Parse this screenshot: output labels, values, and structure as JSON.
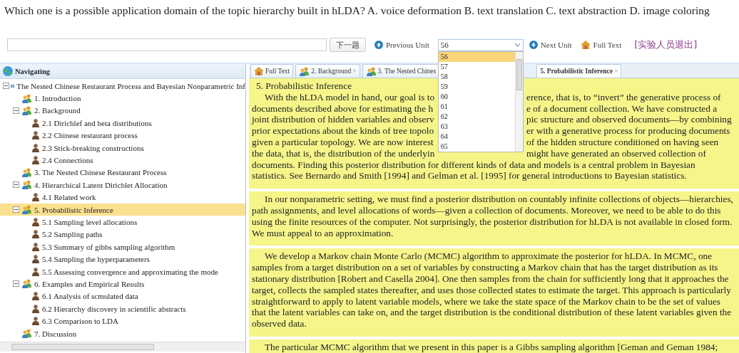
{
  "question": "Which one is a possible application domain of the topic hierarchy built in hLDA? A. voice deformation B. text translation C. text abstraction D. image coloring",
  "toolbar": {
    "next_question": "下一题",
    "previous_unit": "Previous Unit",
    "unit_select": {
      "value": "56",
      "options": [
        {
          "label": "56",
          "selected": true
        },
        {
          "label": "57",
          "selected": false
        },
        {
          "label": "58",
          "selected": false
        },
        {
          "label": "59",
          "selected": false
        },
        {
          "label": "60",
          "selected": false
        },
        {
          "label": "61",
          "selected": false
        },
        {
          "label": "62",
          "selected": false
        },
        {
          "label": "63",
          "selected": false
        },
        {
          "label": "64",
          "selected": false
        },
        {
          "label": "65",
          "selected": false
        }
      ]
    },
    "next_unit": "Next Unit",
    "full_text": "Full Text",
    "exit": "[实验人员退出]"
  },
  "sidebar": {
    "title": "Navigating",
    "tree": [
      {
        "label": "The Nested Chinese Restaurant Process and Bayesian Nonparametric Inf",
        "expanded": true,
        "selected": false,
        "children": [
          {
            "label": "1. Introduction",
            "selected": false
          },
          {
            "label": "2. Background",
            "expanded": true,
            "selected": false,
            "children": [
              {
                "label": "2.1 Dirichlef and beta distributions",
                "selected": false
              },
              {
                "label": "2.2 Chinese restaurant process",
                "selected": false
              },
              {
                "label": "2.3 Stick-breaking constructions",
                "selected": false
              },
              {
                "label": "2.4 Connections",
                "selected": false
              }
            ]
          },
          {
            "label": "3. The Nested Chinese Restaurant Process",
            "selected": false
          },
          {
            "label": "4. Hierarchical Latent Dirichlet Allocation",
            "expanded": true,
            "selected": false,
            "children": [
              {
                "label": "4.1 Related work",
                "selected": false
              }
            ]
          },
          {
            "label": "5. Probabilistic Inference",
            "expanded": true,
            "selected": true,
            "children": [
              {
                "label": "5.1 Sampling level allocations",
                "selected": false
              },
              {
                "label": "5.2 Sampling paths",
                "selected": false
              },
              {
                "label": "5.3 Summary of gibbs sampling algorithm",
                "selected": false
              },
              {
                "label": "5.4 Sampling the hyperparameters",
                "selected": false
              },
              {
                "label": "5.5 Assessing convergence and approximating the mode",
                "selected": false
              }
            ]
          },
          {
            "label": "6. Examples and Empirical Results",
            "expanded": true,
            "selected": false,
            "children": [
              {
                "label": "6.1 Analysis of scmulated data",
                "selected": false
              },
              {
                "label": "6.2 Hierarchy discovery in scientific abstracts",
                "selected": false
              },
              {
                "label": "6.3 Comparison to LDA",
                "selected": false
              }
            ]
          },
          {
            "label": "7. Discussion",
            "selected": false
          }
        ]
      }
    ]
  },
  "tabs": [
    {
      "label": "Full Text",
      "kind": "home",
      "selected": false
    },
    {
      "label": "2. Background",
      "kind": "section",
      "close": "×",
      "selected": false
    },
    {
      "label": "3. The Nested Chines",
      "kind": "section",
      "selected": false
    },
    {
      "label": "5. Probabilistic Inference",
      "kind": "section",
      "close": "×",
      "selected": true
    }
  ],
  "content": {
    "heading": "5. Probabilistic Inference",
    "covered_lines": [
      {
        "left": "With the hLDA model in hand, our goal is to",
        "right": "erence, that is, to “invert” the generative process of"
      },
      {
        "left": "documents described above for estimating the h",
        "right": "e of a document collection. We have constructed a"
      },
      {
        "left": "joint distribution of hidden variables and observ",
        "right": "pic structure and observed documents—by combining"
      },
      {
        "left": "prior expectations about the kinds of tree topolo",
        "right": "er with a generative process for producing documents"
      },
      {
        "left": "given a particular topology. We are now interest",
        "right": "of the hidden structure conditioned on having seen"
      },
      {
        "left": "the data, that is, the distribution of the underlyin",
        "right": "might have generated an observed collection of"
      }
    ],
    "rest_lines": [
      "documents. Finding this posterior distribution for different kinds of data and models is a central problem in Bayesian",
      "statistics. See Bernardo and Smith [1994] and Gelman et al. [1995] for general introductions to Bayesian statistics."
    ],
    "paragraphs": [
      "In our nonparametric setting, we must find a posterior distribution on countably infinite collections of objects—hierarchies, path assignments, and level allocations of words—given a collection of documents. Moreover, we need to be able to do this using the finite resources of the computer. Not surprisingly, the posterior distribution for hLDA is not available in closed form. We must appeal to an approximation.",
      "We develop a Markov chain Monte Carlo (MCMC) algorithm to approximate the posterior for hLDA. In MCMC, one samples from a target distribution on a set of variables by constructing a Markov chain that has the target distribution as its stationary distribution [Robert and Casella 2004]. One then samples from the chain for sufficiently long that it approaches the target, collects the sampled states thereafter, and uses those collected states to estimate the target. This approach is particularly straightforward to apply to latent variable models, where we take the state space of the Markov chain to be the set of values that the latent variables can take on, and the target distribution is the conditional distribution of these latent variables given the observed data.",
      "The particular MCMC algorithm that we present in this paper is a Gibbs sampling algorithm [Geman and Geman 1984;"
    ]
  }
}
